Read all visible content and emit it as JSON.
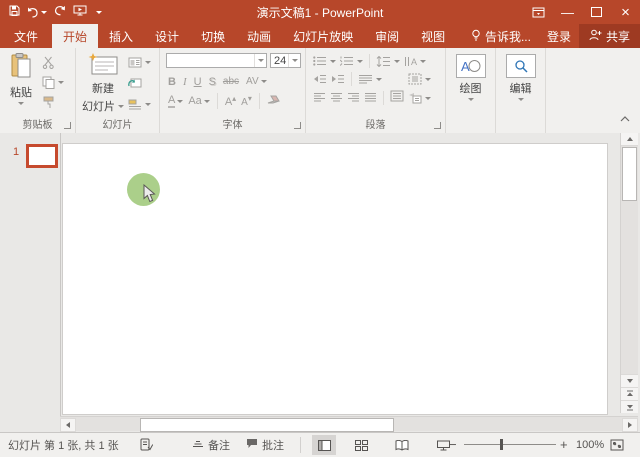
{
  "titlebar": {
    "title": "演示文稿1 - PowerPoint"
  },
  "tabs": {
    "file": "文件",
    "items": [
      "开始",
      "插入",
      "设计",
      "切换",
      "动画",
      "幻灯片放映",
      "审阅",
      "视图"
    ],
    "active_tab": "开始",
    "tell_me": "告诉我...",
    "sign_in": "登录",
    "share": "共享"
  },
  "ribbon": {
    "clipboard": {
      "label": "剪贴板",
      "paste": "粘贴"
    },
    "slides": {
      "label": "幻灯片",
      "new_slide": [
        "新建",
        "幻灯片"
      ]
    },
    "font": {
      "label": "字体",
      "size_value": "24",
      "bold": "B",
      "italic": "I",
      "underline": "U",
      "shadow": "S",
      "strikethrough": "abc",
      "char_spacing": "AV",
      "font_color": "A",
      "change_case": "Aa",
      "grow_font": "A",
      "shrink_font": "A"
    },
    "paragraph": {
      "label": "段落"
    },
    "drawing": {
      "label": "绘图"
    },
    "editing": {
      "label": "编辑"
    }
  },
  "slide_panel": {
    "slide_number": "1"
  },
  "status_bar": {
    "slide_info": "幻灯片 第 1 张, 共 1 张",
    "notes_label": "备注",
    "comments_label": "批注",
    "zoom_level": "100%"
  },
  "icons": {
    "quick_access": [
      "save-icon",
      "undo-icon",
      "redo-icon",
      "start-slideshow-icon",
      "customize-qat-icon"
    ],
    "window": [
      "ribbon-display-options-icon",
      "minimize-icon",
      "maximize-icon",
      "close-icon"
    ],
    "status": [
      "spell-check-icon",
      "notes-icon",
      "comments-icon",
      "normal-view-icon",
      "slide-sorter-icon",
      "reading-view-icon",
      "slideshow-view-icon",
      "fit-to-window-icon"
    ]
  },
  "colors": {
    "titlebar": "#B7472A",
    "accent": "#B7472A",
    "share_button": "#9E3A22",
    "cursor_highlight": "#A6CC84",
    "selected_thumb_border": "#C64A2E"
  }
}
